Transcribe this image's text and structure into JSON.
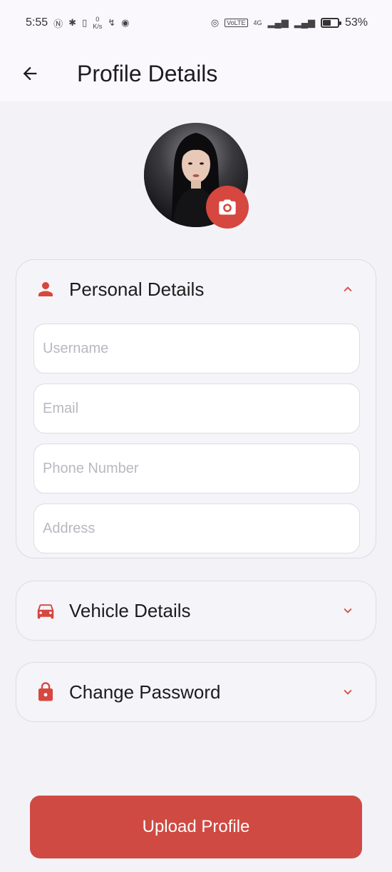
{
  "status_bar": {
    "time": "5:55",
    "speed_value": "0",
    "speed_unit": "K/s",
    "volte": "VoLTE",
    "network": "4G",
    "battery_percent": "53%",
    "battery_level": 0.53
  },
  "app_bar": {
    "title": "Profile Details",
    "back_icon": "arrow-left-icon"
  },
  "avatar": {
    "camera_icon": "camera-icon"
  },
  "sections": {
    "personal": {
      "title": "Personal Details",
      "icon": "person-icon",
      "expanded": true,
      "fields": {
        "username_placeholder": "Username",
        "email_placeholder": "Email",
        "phone_placeholder": "Phone Number",
        "address_placeholder": "Address"
      }
    },
    "vehicle": {
      "title": "Vehicle Details",
      "icon": "car-icon",
      "expanded": false
    },
    "password": {
      "title": "Change Password",
      "icon": "lock-icon",
      "expanded": false
    }
  },
  "upload_button": {
    "label": "Upload Profile"
  },
  "colors": {
    "accent": "#d5473f",
    "button": "#cf4a42",
    "background": "#f2f2f7"
  }
}
